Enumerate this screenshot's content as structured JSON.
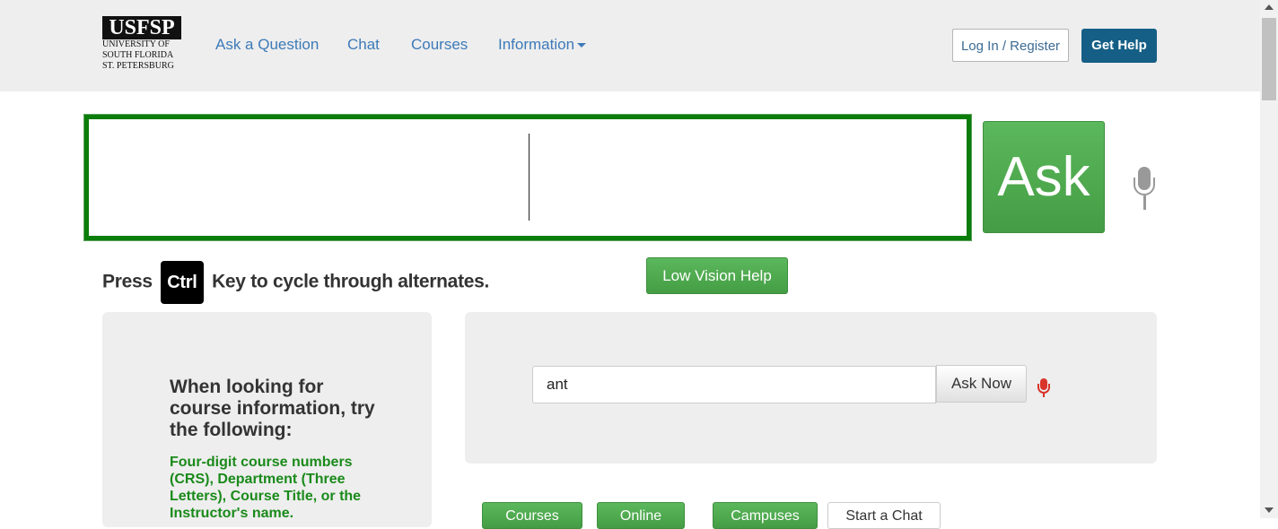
{
  "header": {
    "logo": {
      "mark": "USFSP",
      "lines": [
        "UNIVERSITY OF",
        "SOUTH FLORIDA",
        "ST. PETERSBURG"
      ]
    },
    "nav": [
      {
        "label": "Ask a Question"
      },
      {
        "label": "Chat"
      },
      {
        "label": "Courses"
      },
      {
        "label": "Information"
      }
    ],
    "login_label": "Log In / Register",
    "help_label": "Get Help"
  },
  "ask_box": {
    "value": "",
    "button_label": "Ask"
  },
  "hint": {
    "prefix": "Press",
    "key": "Ctrl",
    "suffix": "Key to cycle through alternates."
  },
  "low_vision_label": "Low Vision Help",
  "tips": {
    "heading": "When looking for course information, try the following:",
    "body": "Four-digit course numbers (CRS), Department (Three Letters), Course Title, or the Instructor's name."
  },
  "quick_ask": {
    "value": "ant",
    "button_label": "Ask Now"
  },
  "bottom_buttons": [
    {
      "label": "Courses",
      "style": "green"
    },
    {
      "label": "Online",
      "style": "green"
    },
    {
      "label": "Campuses",
      "style": "green"
    },
    {
      "label": "Start a Chat",
      "style": "white"
    }
  ],
  "colors": {
    "nav_link": "#3d7ab8",
    "help_button": "#155f86",
    "ask_green": "#5cb85c",
    "input_border": "#0a7d0a",
    "tip_green": "#1a8a1a",
    "mic_active": "#d9342b",
    "mic_idle": "#999999"
  },
  "icons": [
    "caret-down-icon",
    "microphone-icon",
    "microphone-red-icon"
  ]
}
